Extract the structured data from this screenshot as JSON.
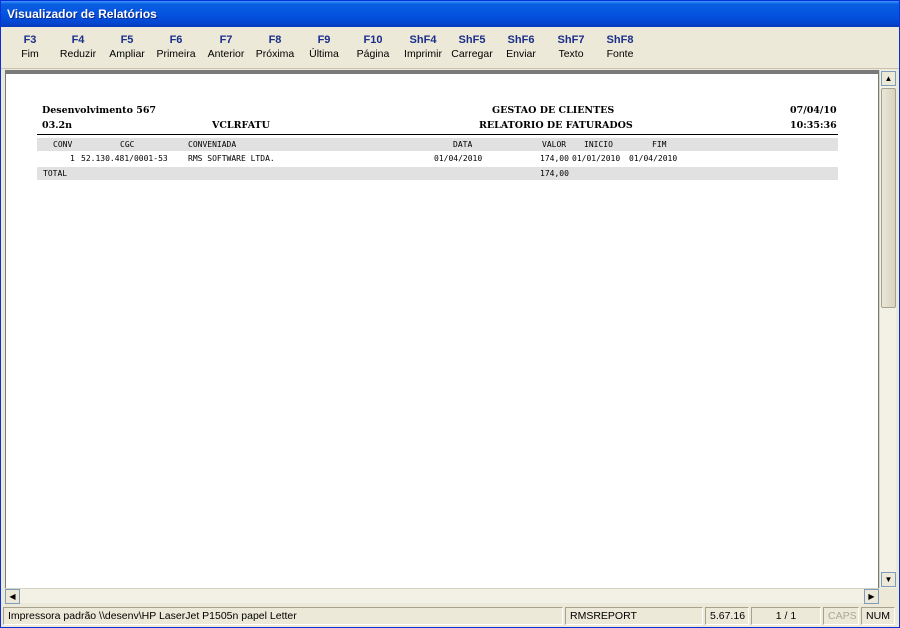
{
  "window": {
    "title": "Visualizador de Relatórios"
  },
  "toolbar": [
    {
      "key": "F3",
      "label": "Fim"
    },
    {
      "key": "F4",
      "label": "Reduzir"
    },
    {
      "key": "F5",
      "label": "Ampliar"
    },
    {
      "key": "F6",
      "label": "Primeira"
    },
    {
      "key": "F7",
      "label": "Anterior"
    },
    {
      "key": "F8",
      "label": "Próxima"
    },
    {
      "key": "F9",
      "label": "Última"
    },
    {
      "key": "F10",
      "label": "Página"
    },
    {
      "key": "ShF4",
      "label": "Imprimir"
    },
    {
      "key": "ShF5",
      "label": "Carregar"
    },
    {
      "key": "ShF6",
      "label": "Enviar"
    },
    {
      "key": "ShF7",
      "label": "Texto"
    },
    {
      "key": "ShF8",
      "label": "Fonte"
    }
  ],
  "report": {
    "company": "Desenvolvimento 567",
    "version": "03.2n",
    "program": "VCLRFATU",
    "title": "GESTAO DE CLIENTES",
    "subtitle": "RELATORIO DE FATURADOS",
    "date": "07/04/10",
    "time": "10:35:36",
    "columns": {
      "conv": "CONV",
      "cgc": "CGC",
      "conveniada": "CONVENIADA",
      "data": "DATA",
      "valor": "VALOR",
      "inicio": "INICIO",
      "fim": "FIM"
    },
    "rows": [
      {
        "conv": "1",
        "cgc": "52.130.481/0001-53",
        "conveniada": "RMS SOFTWARE LTDA.",
        "data": "01/04/2010",
        "valor": "174,00",
        "inicio": "01/01/2010",
        "fim": "01/04/2010"
      }
    ],
    "total_label": "TOTAL",
    "total_value": "174,00"
  },
  "scroll_icons": {
    "up": "arrow-up-icon",
    "down": "arrow-down-icon",
    "left": "arrow-left-icon",
    "right": "arrow-right-icon"
  },
  "status": {
    "printer": "Impressora padrão \\\\desenv\\HP LaserJet P1505n papel Letter",
    "module": "RMSREPORT",
    "version": "5.67.16",
    "page": "1 / 1",
    "caps": "CAPS",
    "num": "NUM"
  },
  "colors": {
    "title_bar": "#0454e0",
    "key_text": "#1a2e8a",
    "band": "#e1e1e1"
  }
}
